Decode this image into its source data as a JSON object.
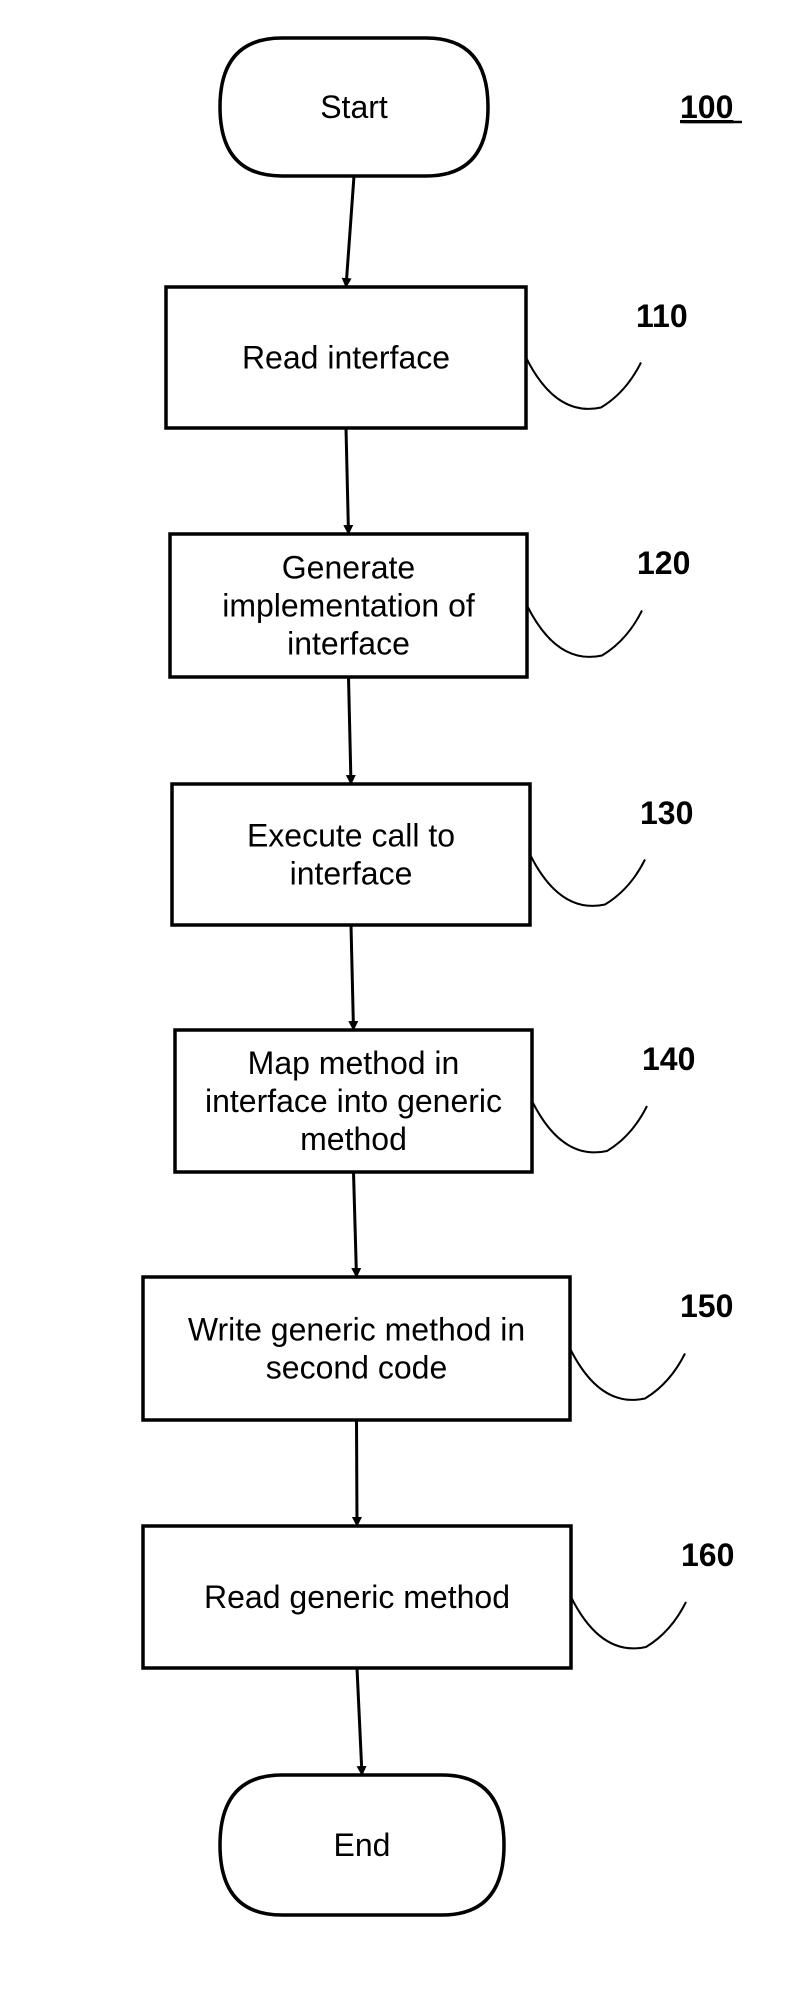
{
  "figure": {
    "ref_label": "100",
    "start": "Start",
    "end": "End",
    "steps": [
      {
        "ref": "110",
        "lines": [
          "Read interface"
        ]
      },
      {
        "ref": "120",
        "lines": [
          "Generate",
          "implementation of",
          "interface"
        ]
      },
      {
        "ref": "130",
        "lines": [
          "Execute call to",
          "interface"
        ]
      },
      {
        "ref": "140",
        "lines": [
          "Map method in",
          "interface into generic",
          "method"
        ]
      },
      {
        "ref": "150",
        "lines": [
          "Write generic method in",
          "second code"
        ]
      },
      {
        "ref": "160",
        "lines": [
          "Read generic method"
        ]
      }
    ]
  }
}
